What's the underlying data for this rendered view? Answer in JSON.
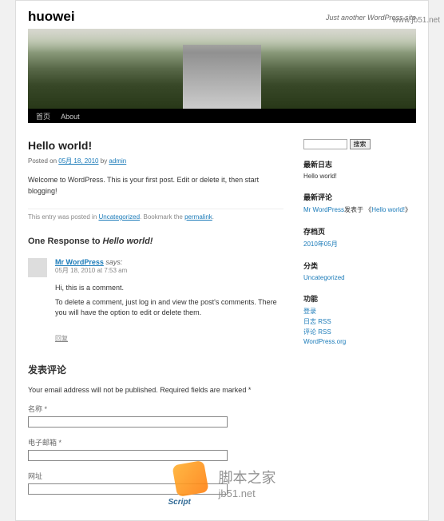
{
  "header": {
    "title": "huowei",
    "tagline": "Just another WordPress site",
    "url_overlay": "www.jb51.net"
  },
  "nav": {
    "home": "首页",
    "about": "About"
  },
  "post": {
    "title": "Hello world!",
    "meta_posted": "Posted on ",
    "meta_date": "05月 18, 2010",
    "meta_by": " by ",
    "meta_author": "admin",
    "content": "Welcome to WordPress. This is your first post. Edit or delete it, then start blogging!",
    "posted_in_prefix": "This entry was posted in ",
    "posted_in_cat": "Uncategorized",
    "posted_in_mid": ". Bookmark the ",
    "posted_in_link": "permalink"
  },
  "responses": {
    "prefix": "One Response to ",
    "title_em": "Hello world!"
  },
  "comment": {
    "author": "Mr WordPress",
    "says": "says:",
    "date": "05月 18, 2010 at 7:53 am",
    "text1": "Hi, this is a comment.",
    "text2": "To delete a comment, just log in and view the post's comments. There you will have the option to edit or delete them.",
    "reply": "回复"
  },
  "form": {
    "title": "发表评论",
    "notice": "Your email address will not be published. Required fields are marked ",
    "req": "*",
    "name_label": "名称 ",
    "email_label": "电子邮箱 ",
    "url_label": "网址"
  },
  "sidebar": {
    "search_btn": "搜索",
    "recent_posts": {
      "title": "最新日志",
      "items": [
        "Hello world!"
      ]
    },
    "recent_comments": {
      "title": "最新评论",
      "author": "Mr WordPress",
      "mid": "发表于 《",
      "post": "Hello world!",
      "end": "》"
    },
    "archives": {
      "title": "存档页",
      "items": [
        "2010年05月"
      ]
    },
    "categories": {
      "title": "分类",
      "items": [
        "Uncategorized"
      ]
    },
    "meta": {
      "title": "功能",
      "items": [
        "登录",
        "日志 RSS",
        "评论 RSS",
        "WordPress.org"
      ]
    }
  },
  "watermark": {
    "script": "Script",
    "text": "脚本之家",
    "url": "jb51.net"
  }
}
